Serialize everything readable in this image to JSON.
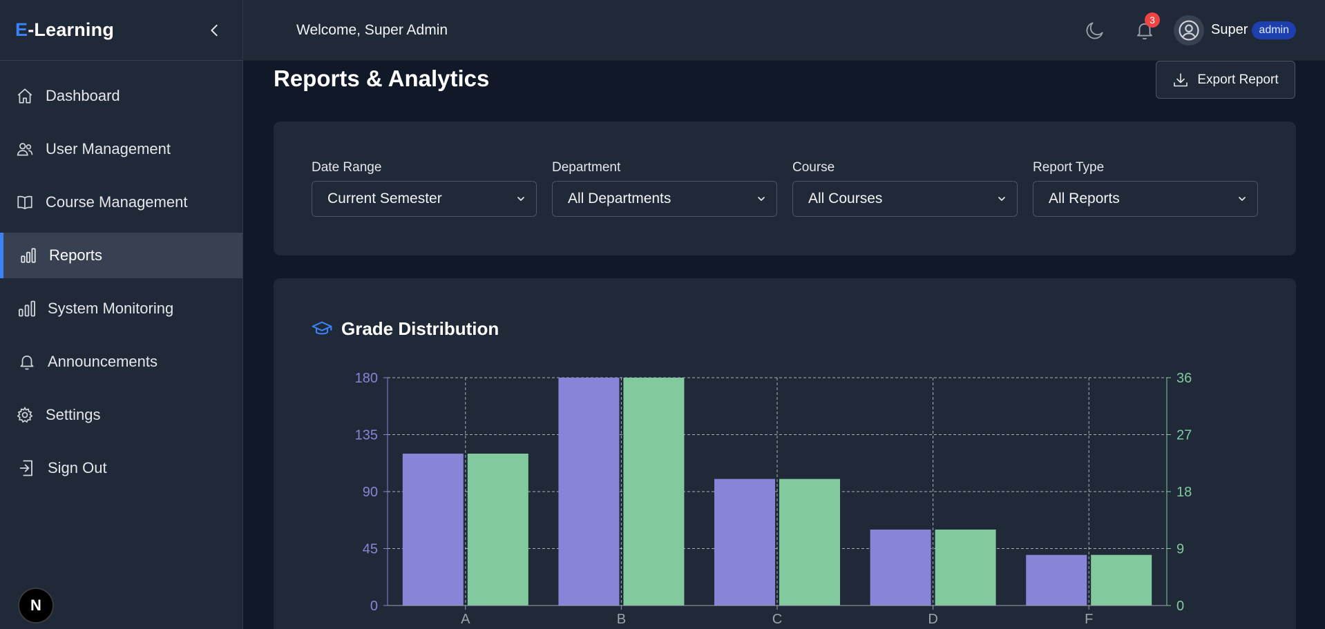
{
  "brand": {
    "accent": "E",
    "rest": "-Learning"
  },
  "sidebar": {
    "items": [
      {
        "label": "Dashboard",
        "icon": "home-icon",
        "active": false
      },
      {
        "label": "User Management",
        "icon": "users-icon",
        "active": false
      },
      {
        "label": "Course Management",
        "icon": "book-icon",
        "active": false
      },
      {
        "label": "Reports",
        "icon": "bar-chart-icon",
        "active": true
      },
      {
        "label": "System Monitoring",
        "icon": "bar-chart-icon",
        "active": false
      },
      {
        "label": "Announcements",
        "icon": "bell-icon",
        "active": false
      },
      {
        "label": "Settings",
        "icon": "gear-icon",
        "active": false
      },
      {
        "label": "Sign Out",
        "icon": "sign-out-icon",
        "active": false
      }
    ],
    "next_badge": "N"
  },
  "header": {
    "welcome": "Welcome, Super Admin",
    "notification_count": "3",
    "user_name": "Super",
    "role": "admin"
  },
  "page": {
    "title": "Reports & Analytics",
    "export_label": "Export Report"
  },
  "filters": [
    {
      "label": "Date Range",
      "value": "Current Semester"
    },
    {
      "label": "Department",
      "value": "All Departments"
    },
    {
      "label": "Course",
      "value": "All Courses"
    },
    {
      "label": "Report Type",
      "value": "All Reports"
    }
  ],
  "colors": {
    "accent": "#3b82f6",
    "series_left": "#8884d8",
    "series_right": "#82ca9d",
    "badge_red": "#ef4444"
  },
  "chart_data": {
    "type": "bar",
    "title": "Grade Distribution",
    "categories": [
      "A",
      "B",
      "C",
      "D",
      "F"
    ],
    "series": [
      {
        "values": [
          120,
          180,
          100,
          60,
          40
        ],
        "axis": "left",
        "color": "#8884d8"
      },
      {
        "values": [
          24,
          36,
          20,
          12,
          8
        ],
        "axis": "right",
        "color": "#82ca9d"
      }
    ],
    "y_left": {
      "ticks": [
        0,
        45,
        90,
        135,
        180
      ],
      "ylim": [
        0,
        180
      ]
    },
    "y_right": {
      "ticks": [
        0,
        9,
        18,
        27,
        36
      ],
      "ylim": [
        0,
        36
      ]
    },
    "grid": true,
    "grid_style": "dashed"
  }
}
